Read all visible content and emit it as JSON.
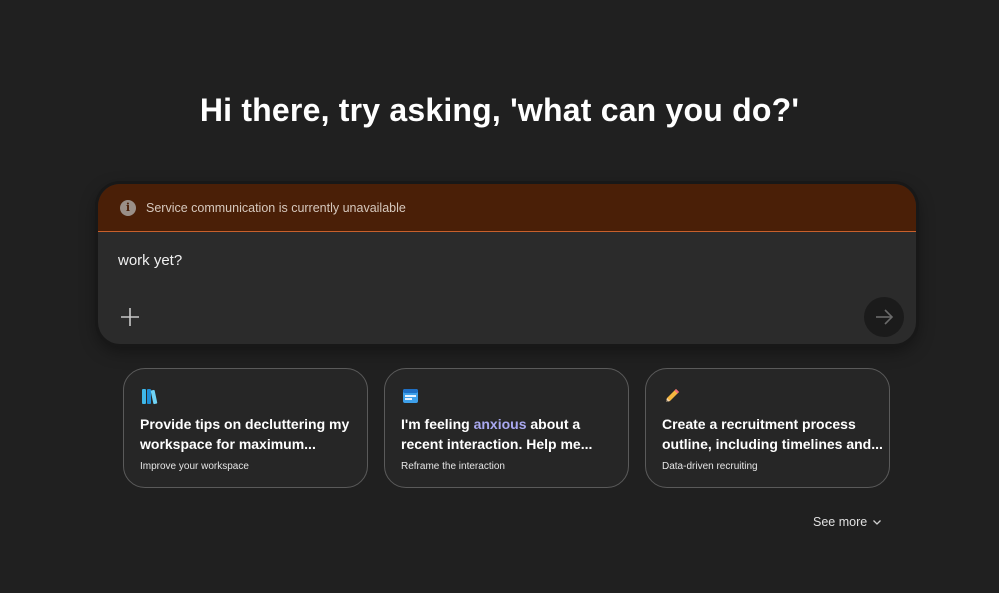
{
  "headline": "Hi there, try asking, 'what can you do?'",
  "banner": {
    "message": "Service communication is currently unavailable"
  },
  "composer": {
    "text": "work yet?"
  },
  "cards": [
    {
      "title_line1": "Provide tips on decluttering my",
      "title_line2": "workspace for maximum...",
      "subtitle": "Improve your workspace",
      "icon": "books-icon"
    },
    {
      "title_line1_pre": "I'm feeling ",
      "title_line1_highlight": "anxious",
      "title_line1_post": " about a",
      "title_line2": "recent interaction. Help me...",
      "subtitle": "Reframe the interaction",
      "icon": "calendar-icon"
    },
    {
      "title_line1": "Create a recruitment process",
      "title_line2": "outline, including timelines and...",
      "subtitle": "Data-driven recruiting",
      "icon": "pencil-icon"
    }
  ],
  "see_more": "See more",
  "colors": {
    "background": "#202020",
    "banner_bg": "#4a1f07",
    "banner_border": "#c8602c",
    "highlight": "#a9a8f0"
  }
}
